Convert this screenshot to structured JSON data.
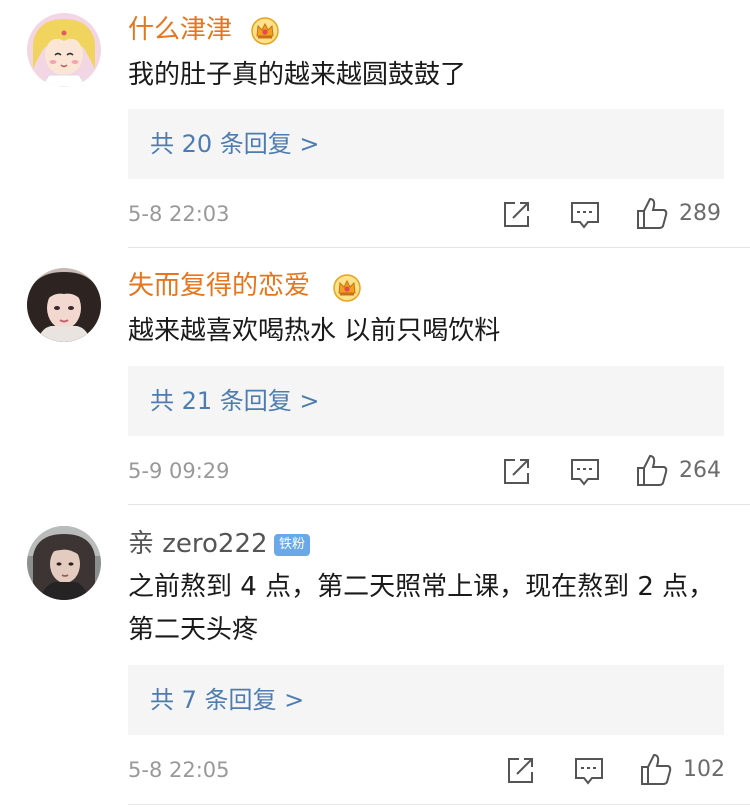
{
  "comments": [
    {
      "username": "什么津津",
      "has_crown": true,
      "content": "我的肚子真的越来越圆鼓鼓了",
      "replies_label": "共 20 条回复 >",
      "timestamp": "5-8 22:03",
      "likes": "289"
    },
    {
      "username": "失而复得的恋爱",
      "has_crown": true,
      "content": "越来越喜欢喝热水 以前只喝饮料",
      "replies_label": "共 21 条回复 >",
      "timestamp": "5-9 09:29",
      "likes": "264"
    },
    {
      "username": "亲 zero222",
      "badge": "铁粉",
      "content": "之前熬到 4 点，第二天照常上课，现在熬到 2 点，第二天头疼",
      "replies_label": "共 7 条回复 >",
      "timestamp": "5-8 22:05",
      "likes": "102"
    }
  ],
  "icons": {
    "share": "share-icon",
    "comment": "comment-icon",
    "like": "thumbs-up-icon",
    "crown": "crown-icon"
  },
  "colors": {
    "vip_name": "#e8741c",
    "normal_name": "#555555",
    "reply_link": "#4f7cb0",
    "reply_bg": "#f5f5f5",
    "fan_badge": "#6aa8e8",
    "meta_text": "#999999"
  }
}
